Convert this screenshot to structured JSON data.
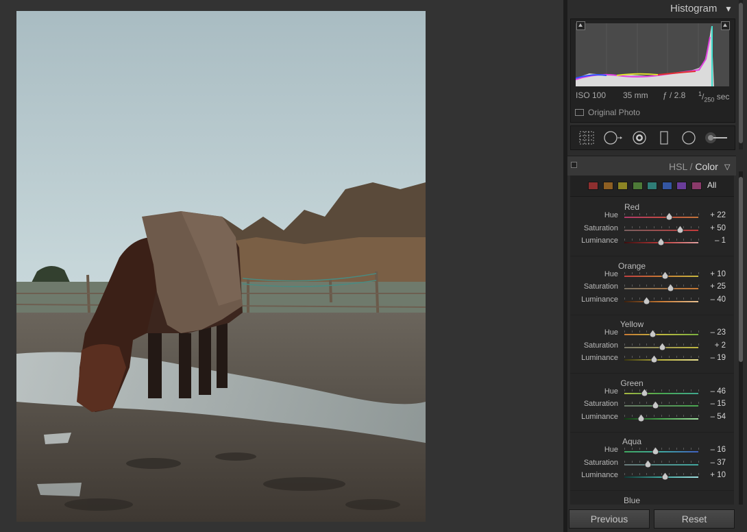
{
  "panels": {
    "histogram": {
      "title": "Histogram",
      "iso": "ISO 100",
      "focal_length": "35 mm",
      "aperture": "ƒ / 2.8",
      "shutter_num": "1",
      "shutter_den": "250",
      "shutter_unit": "sec",
      "original_photo_label": "Original Photo"
    },
    "hsl": {
      "title_hsl": "HSL",
      "title_sep": " / ",
      "title_color": "Color",
      "all_label": "All",
      "swatches": [
        "#8e2f2f",
        "#8e5f22",
        "#8c8424",
        "#4d7a37",
        "#2f7d77",
        "#3456a3",
        "#6a3d9a",
        "#8a3a6a"
      ],
      "labels": {
        "hue": "Hue",
        "saturation": "Saturation",
        "luminance": "Luminance"
      },
      "groups": [
        {
          "name": "Red",
          "hue": {
            "value": 22,
            "display": "+ 22"
          },
          "saturation": {
            "value": 50,
            "display": "+ 50"
          },
          "luminance": {
            "value": -1,
            "display": "– 1"
          }
        },
        {
          "name": "Orange",
          "hue": {
            "value": 10,
            "display": "+ 10"
          },
          "saturation": {
            "value": 25,
            "display": "+ 25"
          },
          "luminance": {
            "value": -40,
            "display": "– 40"
          }
        },
        {
          "name": "Yellow",
          "hue": {
            "value": -23,
            "display": "– 23"
          },
          "saturation": {
            "value": 2,
            "display": "+ 2"
          },
          "luminance": {
            "value": -19,
            "display": "– 19"
          }
        },
        {
          "name": "Green",
          "hue": {
            "value": -46,
            "display": "– 46"
          },
          "saturation": {
            "value": -15,
            "display": "– 15"
          },
          "luminance": {
            "value": -54,
            "display": "– 54"
          }
        },
        {
          "name": "Aqua",
          "hue": {
            "value": -16,
            "display": "– 16"
          },
          "saturation": {
            "value": -37,
            "display": "– 37"
          },
          "luminance": {
            "value": 10,
            "display": "+ 10"
          }
        }
      ],
      "next_group": "Blue"
    }
  },
  "buttons": {
    "previous": "Previous",
    "reset": "Reset"
  }
}
